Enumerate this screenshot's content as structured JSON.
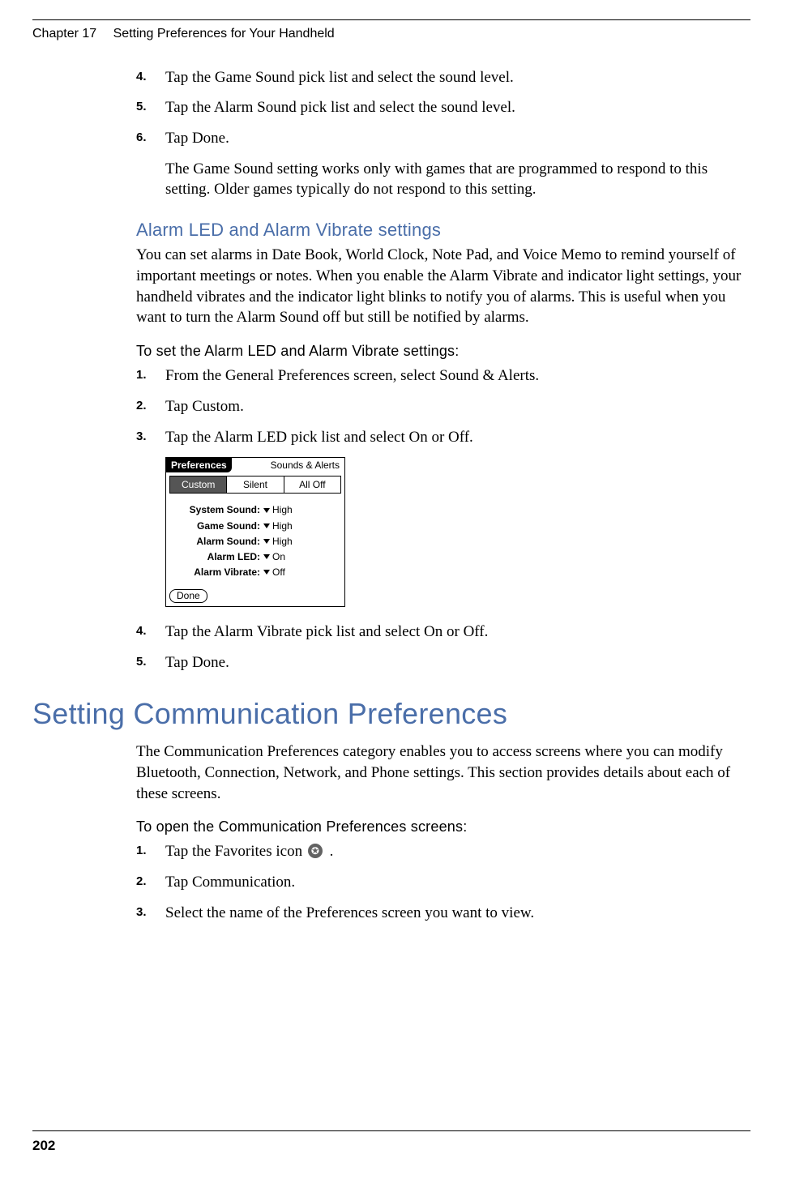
{
  "header": {
    "chapter": "Chapter 17",
    "title": "Setting Preferences for Your Handheld"
  },
  "page_number": "202",
  "steps_top": {
    "s4": {
      "num": "4.",
      "text": "Tap the Game Sound pick list and select the sound level."
    },
    "s5": {
      "num": "5.",
      "text": "Tap the Alarm Sound pick list and select the sound level."
    },
    "s6": {
      "num": "6.",
      "text": "Tap Done."
    },
    "note": "The Game Sound setting works only with games that are programmed to respond to this setting. Older games typically do not respond to this setting."
  },
  "section1": {
    "heading": "Alarm LED and Alarm Vibrate settings",
    "body": "You can set alarms in Date Book, World Clock, Note Pad, and Voice Memo to remind yourself of important meetings or notes. When you enable the Alarm Vibrate and indicator light settings, your handheld vibrates and the indicator light blinks to notify you of alarms. This is useful when you want to turn the Alarm Sound off but still be notified by alarms.",
    "proc_heading": "To set the Alarm LED and Alarm Vibrate settings:",
    "steps123": {
      "s1": {
        "num": "1.",
        "text": "From the General Preferences screen, select Sound & Alerts."
      },
      "s2": {
        "num": "2.",
        "text": "Tap Custom."
      },
      "s3": {
        "num": "3.",
        "text": "Tap the Alarm LED pick list and select On or Off."
      }
    },
    "palm": {
      "title": "Preferences",
      "category": "Sounds & Alerts",
      "tabs": {
        "custom": "Custom",
        "silent": "Silent",
        "alloff": "All Off"
      },
      "rows": {
        "system": {
          "label": "System Sound:",
          "value": "High"
        },
        "game": {
          "label": "Game Sound:",
          "value": "High"
        },
        "alarm": {
          "label": "Alarm Sound:",
          "value": "High"
        },
        "led": {
          "label": "Alarm LED:",
          "value": "On"
        },
        "vibrate": {
          "label": "Alarm Vibrate:",
          "value": "Off"
        }
      },
      "done": "Done"
    },
    "steps45": {
      "s4": {
        "num": "4.",
        "text": "Tap the Alarm Vibrate pick list and select On or Off."
      },
      "s5": {
        "num": "5.",
        "text": "Tap Done."
      }
    }
  },
  "section2": {
    "heading": "Setting Communication Preferences",
    "body": "The Communication Preferences category enables you to access screens where you can modify Bluetooth, Connection, Network, and Phone settings. This section provides details about each of these screens.",
    "proc_heading": "To open the Communication Preferences screens:",
    "steps": {
      "s1": {
        "num": "1.",
        "text_a": "Tap the Favorites icon ",
        "text_b": "."
      },
      "s2": {
        "num": "2.",
        "text": "Tap Communication."
      },
      "s3": {
        "num": "3.",
        "text": "Select the name of the Preferences screen you want to view."
      }
    }
  },
  "icons": {
    "favorites_glyph": "✪"
  }
}
